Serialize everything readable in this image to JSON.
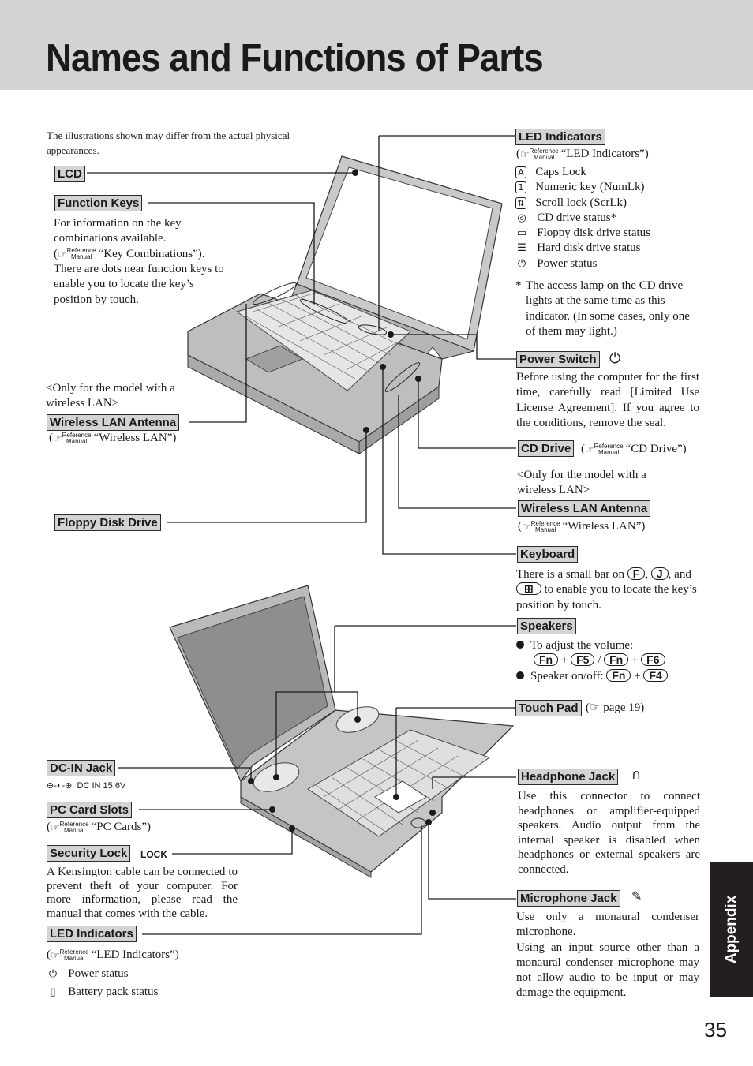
{
  "header": {
    "title": "Names and Functions of Parts"
  },
  "intro_note": "The illustrations shown may differ from the actual physical appearances.",
  "reference": {
    "hand_icon": "pointing-hand-icon",
    "line1": "Reference",
    "line2": "Manual"
  },
  "top_left": {
    "lcd": {
      "label": "LCD"
    },
    "function_keys": {
      "label": "Function Keys",
      "text1": "For information on the key combinations available.",
      "ref_text": "“Key Combinations”).",
      "text2": "There are dots near function keys to enable you to locate the key’s position by touch."
    },
    "wireless_lan": {
      "note": "<Only for the model with a wireless LAN>",
      "label": "Wireless LAN Antenna",
      "ref_text": "“Wireless LAN”)"
    },
    "floppy": {
      "label": "Floppy Disk Drive"
    }
  },
  "top_right": {
    "led": {
      "label": "LED Indicators",
      "ref_text": "“LED Indicators”)",
      "items": [
        {
          "icon": "caps-lock-icon",
          "glyph": "A",
          "text": "Caps Lock"
        },
        {
          "icon": "num-lock-icon",
          "glyph": "1",
          "text": "Numeric key (NumLk)"
        },
        {
          "icon": "scroll-lock-icon",
          "glyph": "⇅",
          "text": "Scroll lock (ScrLk)"
        },
        {
          "icon": "cd-drive-icon",
          "glyph": "◎",
          "text": "CD drive status*"
        },
        {
          "icon": "floppy-disk-icon",
          "glyph": "▭",
          "text": "Floppy disk drive status"
        },
        {
          "icon": "hard-disk-icon",
          "glyph": "☰",
          "text": "Hard disk drive status"
        },
        {
          "icon": "power-status-icon",
          "glyph": "⏻",
          "text": "Power status"
        }
      ],
      "footnote_mark": "*",
      "footnote": "The access lamp on the CD drive lights at the same time as this indicator. (In some cases, only one of them may light.)"
    },
    "power_switch": {
      "label": "Power Switch",
      "icon_glyph": "⏻",
      "text": "Before using the computer for the first time, carefully read [Limited Use License Agreement]. If you agree to the conditions, remove the seal."
    },
    "cd_drive": {
      "label": "CD Drive",
      "ref_text": "“CD Drive”)"
    },
    "wireless_lan": {
      "note": "<Only for the model with a wireless LAN>",
      "label": "Wireless LAN Antenna",
      "ref_text": "“Wireless LAN”)"
    },
    "keyboard": {
      "label": "Keyboard",
      "text_a": "There is a small bar on",
      "key_f": "F",
      "key_j": "J",
      "text_b": "and",
      "key_win": "⊞",
      "text_c": "to enable you to locate the key’s position by touch."
    },
    "speakers": {
      "label": "Speakers",
      "bullet1": "To adjust the volume:",
      "keys1": [
        "Fn",
        "F5",
        "Fn",
        "F6"
      ],
      "plus": "+",
      "slash": "/",
      "bullet2": "Speaker on/off:",
      "keys2": [
        "Fn",
        "F4"
      ]
    },
    "touch_pad": {
      "label": "Touch Pad",
      "ref_text": "page 19)"
    }
  },
  "bottom_left": {
    "dc_in": {
      "label": "DC-IN Jack",
      "polarity": "⊖-◐-⊕",
      "spec": "DC IN 15.6V"
    },
    "pc_card": {
      "label": "PC Card Slots",
      "ref_text": "“PC Cards”)"
    },
    "security": {
      "label": "Security Lock",
      "marking": "LOCK",
      "text": "A Kensington cable can be connected to prevent theft of your computer. For more information, please read the manual that comes with the cable."
    },
    "led": {
      "label": "LED Indicators",
      "ref_text": "“LED Indicators”)",
      "items": [
        {
          "icon": "power-status-icon",
          "glyph": "⏻",
          "text": "Power status"
        },
        {
          "icon": "battery-icon",
          "glyph": "▯",
          "text": "Battery pack status"
        }
      ]
    }
  },
  "bottom_right": {
    "headphone": {
      "label": "Headphone Jack",
      "icon_glyph": "∩",
      "text": "Use this connector to connect headphones or amplifier-equipped speakers. Audio output from the internal speaker is disabled when headphones or external speakers are connected."
    },
    "microphone": {
      "label": "Microphone Jack",
      "icon_glyph": "🎤",
      "text1": "Use only a monaural condenser microphone.",
      "text2": "Using an input source other than a monaural condenser microphone may not allow audio to be input or may damage the equipment."
    }
  },
  "side_tab": "Appendix",
  "page_number": "35"
}
